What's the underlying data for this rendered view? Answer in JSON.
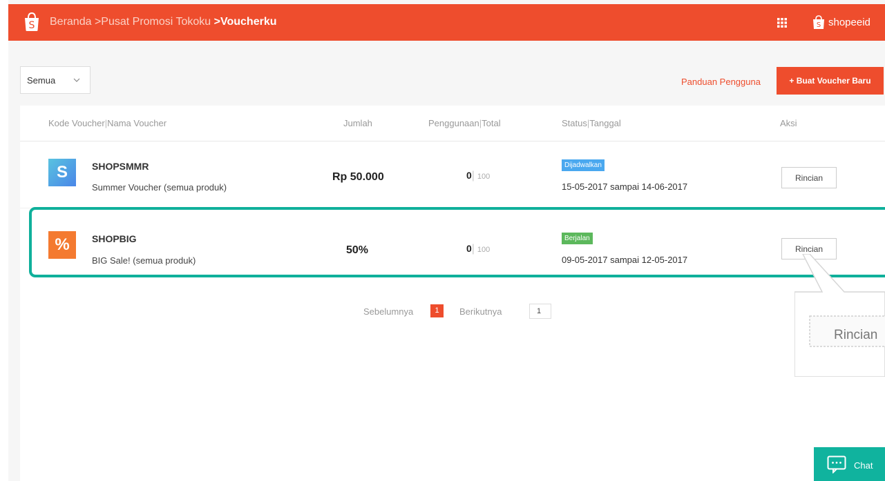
{
  "header": {
    "breadcrumb": [
      {
        "label": "Beranda"
      },
      {
        "label": ">Pusat Promosi Tokoku"
      },
      {
        "label": ">Voucherku"
      }
    ],
    "shop_name": "shopeeid"
  },
  "toolbar": {
    "filter_value": "Semua",
    "guide_link": "Panduan Pengguna",
    "create_button": "+ Buat Voucher Baru"
  },
  "table": {
    "headers": {
      "code": "Kode Voucher",
      "name": "Nama Voucher",
      "amount": "Jumlah",
      "usage": "Penggunaan",
      "total": "Total",
      "status": "Status",
      "date": "Tanggal",
      "action": "Aksi"
    },
    "rows": [
      {
        "icon_glyph": "S",
        "icon": "dollar-icon",
        "code": "SHOPSMMR",
        "name": "Summer Voucher (semua produk)",
        "amount": "Rp 50.000",
        "used": "0",
        "total": "100",
        "status": "Dijadwalkan",
        "date": "15-05-2017 sampai 14-06-2017",
        "action": "Rincian"
      },
      {
        "icon_glyph": "%",
        "icon": "percent-icon",
        "code": "SHOPBIG",
        "name": "BIG Sale! (semua produk)",
        "amount": "50%",
        "used": "0",
        "total": "100",
        "status": "Berjalan",
        "date": "09-05-2017 sampai 12-05-2017",
        "action": "Rincian"
      }
    ]
  },
  "pagination": {
    "prev": "Sebelumnya",
    "current": "1",
    "next": "Berikutnya",
    "input_value": "1"
  },
  "callout_zoom_text": "Rincian",
  "chat": {
    "label": "Chat"
  },
  "colors": {
    "brand": "#ee4d2d",
    "highlight": "#0fb09b",
    "scheduled": "#4aa8ef",
    "running": "#5cb85c"
  }
}
